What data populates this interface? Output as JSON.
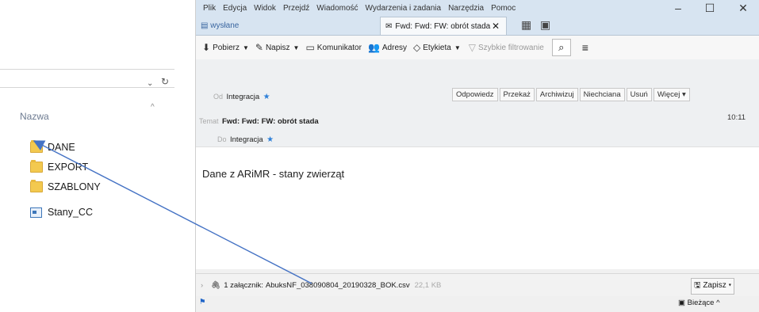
{
  "explorer": {
    "column_header": "Nazwa",
    "items": [
      {
        "name": "DANE",
        "kind": "folder"
      },
      {
        "name": "EXPORT",
        "kind": "folder"
      },
      {
        "name": "SZABLONY",
        "kind": "folder"
      },
      {
        "name": "Stany_CC",
        "kind": "file"
      }
    ]
  },
  "thunderbird": {
    "menu": [
      "Plik",
      "Edycja",
      "Widok",
      "Przejdź",
      "Wiadomość",
      "Wydarzenia i zadania",
      "Narzędzia",
      "Pomoc"
    ],
    "folder_tab": "wysłane",
    "message_tab": "Fwd: Fwd: FW: obrót stada",
    "toolbar": {
      "get": "Pobierz",
      "write": "Napisz",
      "chat": "Komunikator",
      "address": "Adresy",
      "tag": "Etykieta",
      "quick_filter": "Szybkie filtrowanie"
    },
    "header": {
      "from_label": "Od",
      "from_value": "Integracja",
      "subject_label": "Temat",
      "subject_value": "Fwd: Fwd: FW: obrót stada",
      "to_label": "Do",
      "to_value": "Integracja",
      "time": "10:11",
      "buttons": [
        "Odpowiedz",
        "Przekaż",
        "Archiwizuj",
        "Niechciana",
        "Usuń",
        "Więcej"
      ]
    },
    "body_text": "Dane z ARiMR - stany zwierząt",
    "attachment": {
      "label": "1 załącznik:",
      "filename": "AbuksNF_038090804_20190328_BOK.csv",
      "size": "22,1 KB",
      "save": "Zapisz"
    },
    "status": {
      "current": "Bieżące"
    }
  }
}
